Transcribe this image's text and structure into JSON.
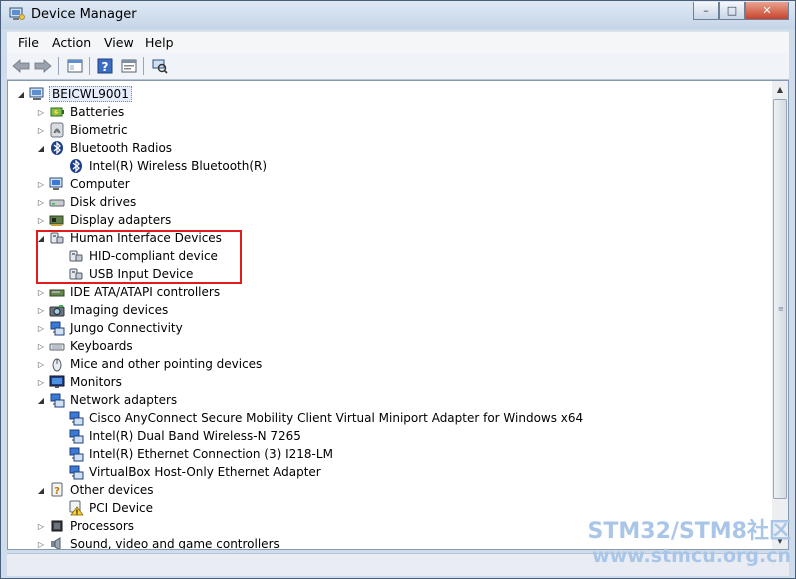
{
  "window": {
    "title": "Device Manager",
    "controls": {
      "minimize": "–",
      "maximize": "□",
      "close": "✕"
    }
  },
  "menu": {
    "items": [
      "File",
      "Action",
      "View",
      "Help"
    ]
  },
  "toolbar": {
    "buttons": [
      "back-icon",
      "forward-icon",
      "show-hide-console-tree-icon",
      "help-icon",
      "properties-icon",
      "scan-hardware-icon"
    ]
  },
  "tree": {
    "root": "BEICWL9001",
    "items": [
      {
        "label": "Batteries",
        "icon": "battery-icon",
        "level": 1,
        "state": "collapsed"
      },
      {
        "label": "Biometric",
        "icon": "biometric-icon",
        "level": 1,
        "state": "collapsed"
      },
      {
        "label": "Bluetooth Radios",
        "icon": "bluetooth-icon",
        "level": 1,
        "state": "expanded"
      },
      {
        "label": "Intel(R) Wireless Bluetooth(R)",
        "icon": "bluetooth-icon",
        "level": 2,
        "state": "leaf"
      },
      {
        "label": "Computer",
        "icon": "computer-icon",
        "level": 1,
        "state": "collapsed"
      },
      {
        "label": "Disk drives",
        "icon": "disk-drive-icon",
        "level": 1,
        "state": "collapsed"
      },
      {
        "label": "Display adapters",
        "icon": "display-adapter-icon",
        "level": 1,
        "state": "collapsed"
      },
      {
        "label": "Human Interface Devices",
        "icon": "hid-icon",
        "level": 1,
        "state": "expanded"
      },
      {
        "label": "HID-compliant device",
        "icon": "hid-icon",
        "level": 2,
        "state": "leaf"
      },
      {
        "label": "USB Input Device",
        "icon": "hid-icon",
        "level": 2,
        "state": "leaf"
      },
      {
        "label": "IDE ATA/ATAPI controllers",
        "icon": "ide-controller-icon",
        "level": 1,
        "state": "collapsed"
      },
      {
        "label": "Imaging devices",
        "icon": "camera-icon",
        "level": 1,
        "state": "collapsed"
      },
      {
        "label": "Jungo Connectivity",
        "icon": "network-device-icon",
        "level": 1,
        "state": "collapsed"
      },
      {
        "label": "Keyboards",
        "icon": "keyboard-icon",
        "level": 1,
        "state": "collapsed"
      },
      {
        "label": "Mice and other pointing devices",
        "icon": "mouse-icon",
        "level": 1,
        "state": "collapsed"
      },
      {
        "label": "Monitors",
        "icon": "monitor-icon",
        "level": 1,
        "state": "collapsed"
      },
      {
        "label": "Network adapters",
        "icon": "network-adapter-icon",
        "level": 1,
        "state": "expanded"
      },
      {
        "label": "Cisco AnyConnect Secure Mobility Client Virtual Miniport Adapter for Windows x64",
        "icon": "network-adapter-icon",
        "level": 2,
        "state": "leaf"
      },
      {
        "label": "Intel(R) Dual Band Wireless-N 7265",
        "icon": "network-adapter-icon",
        "level": 2,
        "state": "leaf"
      },
      {
        "label": "Intel(R) Ethernet Connection (3) I218-LM",
        "icon": "network-adapter-icon",
        "level": 2,
        "state": "leaf"
      },
      {
        "label": "VirtualBox Host-Only Ethernet Adapter",
        "icon": "network-adapter-icon",
        "level": 2,
        "state": "leaf"
      },
      {
        "label": "Other devices",
        "icon": "other-devices-icon",
        "level": 1,
        "state": "expanded"
      },
      {
        "label": "PCI Device",
        "icon": "warning-device-icon",
        "level": 2,
        "state": "leaf"
      },
      {
        "label": "Processors",
        "icon": "processor-icon",
        "level": 1,
        "state": "collapsed"
      },
      {
        "label": "Sound, video and game controllers",
        "icon": "sound-icon",
        "level": 1,
        "state": "collapsed"
      }
    ]
  },
  "watermark": {
    "line1": "STM32/STM8社区",
    "line2": "www.stmcu.org.cn"
  },
  "colors": {
    "highlight": "#e01c1c",
    "watermark": "#a9c6e8",
    "selection": "#e6eefb"
  }
}
